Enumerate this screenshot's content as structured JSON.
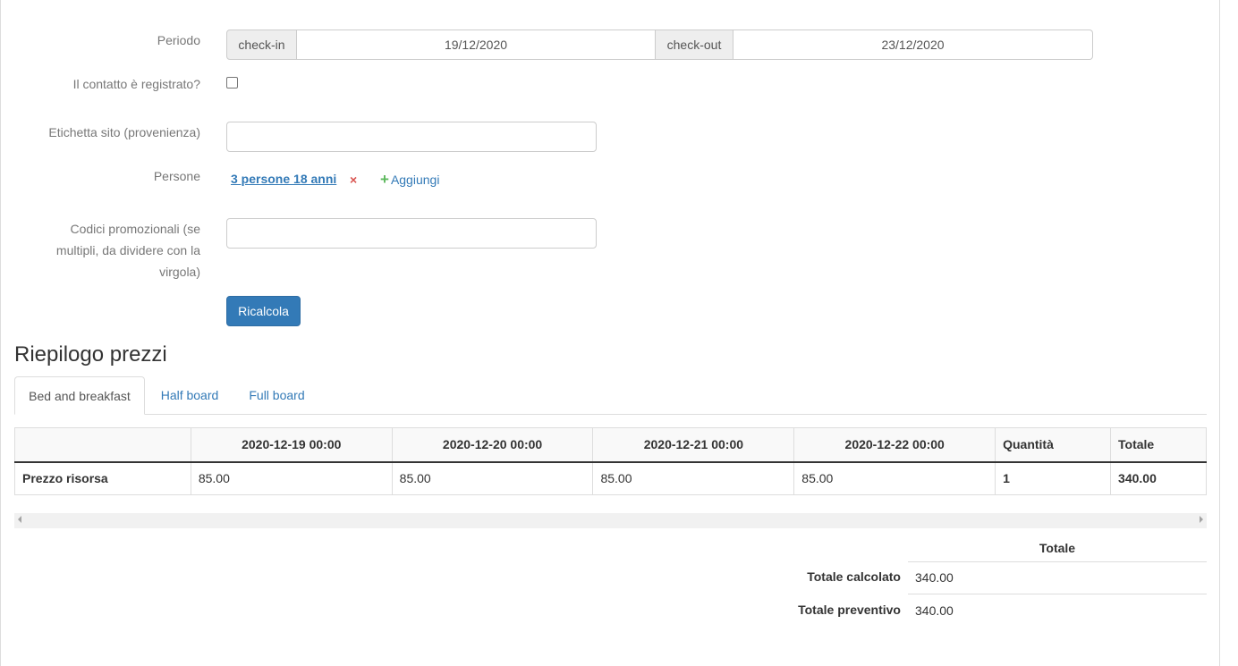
{
  "form": {
    "periodo_label": "Periodo",
    "checkin_addon": "check-in",
    "checkin_value": "19/12/2020",
    "checkout_addon": "check-out",
    "checkout_value": "23/12/2020",
    "registrato_label": "Il contatto è registrato?",
    "etichetta_label": "Etichetta sito (provenienza)",
    "etichetta_value": "",
    "persone_label": "Persone",
    "persone_link": "3 persone 18 anni",
    "remove_symbol": "×",
    "add_label": "Aggiungi",
    "add_symbol": "+",
    "codici_label_1": "Codici promozionali (se",
    "codici_label_2": "multipli, da dividere con la",
    "codici_label_3": "virgola)",
    "codici_value": "",
    "ricalcola_label": "Ricalcola"
  },
  "summary": {
    "title": "Riepilogo prezzi",
    "tabs": [
      {
        "label": "Bed and breakfast",
        "active": true
      },
      {
        "label": "Half board",
        "active": false
      },
      {
        "label": "Full board",
        "active": false
      }
    ],
    "table": {
      "headers": [
        "",
        "2020-12-19 00:00",
        "2020-12-20 00:00",
        "2020-12-21 00:00",
        "2020-12-22 00:00",
        "Quantità",
        "Totale"
      ],
      "rows": [
        [
          "Prezzo risorsa",
          "85.00",
          "85.00",
          "85.00",
          "85.00",
          "1",
          "340.00"
        ]
      ]
    },
    "totals": {
      "header": "Totale",
      "calcolato_label": "Totale calcolato",
      "calcolato_value": "340.00",
      "preventivo_label": "Totale preventivo",
      "preventivo_value": "340.00"
    }
  },
  "colors": {
    "primary": "#337ab7",
    "danger": "#d9534f",
    "success": "#5cb85c"
  }
}
